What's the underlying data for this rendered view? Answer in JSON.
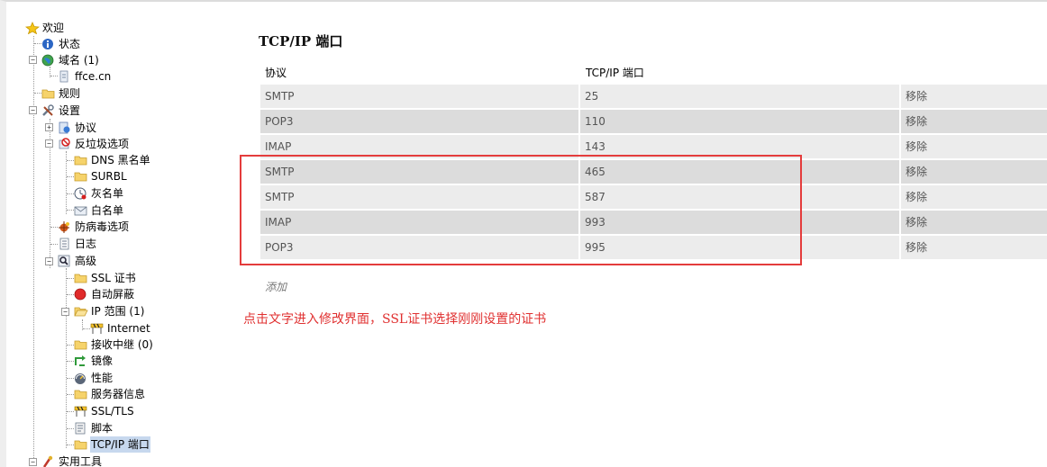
{
  "tree": {
    "welcome": "欢迎",
    "status": "状态",
    "domains": "域名 (1)",
    "domain_ffce": "ffce.cn",
    "rules": "规则",
    "settings": "设置",
    "protocols": "协议",
    "antispam": "反垃圾选项",
    "dns_blacklist": "DNS 黑名单",
    "surbl": "SURBL",
    "greylist": "灰名单",
    "whitelist": "白名单",
    "antivirus": "防病毒选项",
    "logs": "日志",
    "advanced": "高级",
    "ssl_cert": "SSL 证书",
    "auto_ban": "自动屏蔽",
    "ip_ranges": "IP 范围 (1)",
    "internet": "Internet",
    "relay": "接收中继 (0)",
    "mirror": "镜像",
    "performance": "性能",
    "server_info": "服务器信息",
    "ssl_tls": "SSL/TLS",
    "scripts": "脚本",
    "tcpip_ports": "TCP/IP 端口",
    "utilities": "实用工具"
  },
  "main": {
    "title": "TCP/IP 端口",
    "columns": {
      "protocol": "协议",
      "port": "TCP/IP 端口"
    },
    "rows": [
      {
        "protocol": "SMTP",
        "port": "25",
        "action": "移除"
      },
      {
        "protocol": "POP3",
        "port": "110",
        "action": "移除"
      },
      {
        "protocol": "IMAP",
        "port": "143",
        "action": "移除"
      },
      {
        "protocol": "SMTP",
        "port": "465",
        "action": "移除"
      },
      {
        "protocol": "SMTP",
        "port": "587",
        "action": "移除"
      },
      {
        "protocol": "IMAP",
        "port": "993",
        "action": "移除"
      },
      {
        "protocol": "POP3",
        "port": "995",
        "action": "移除"
      }
    ],
    "add_label": "添加"
  },
  "annotation": "点击文字进入修改界面，SSL证书选择刚刚设置的证书",
  "colors": {
    "highlight": "#e43c3c",
    "annotation": "#e03030",
    "selected": "#c7d8ee"
  }
}
